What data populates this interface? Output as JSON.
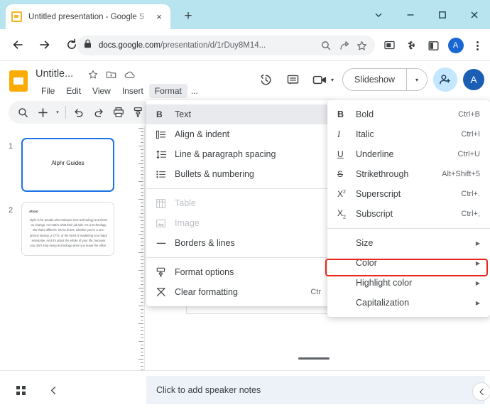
{
  "browser": {
    "tab": {
      "title": "Untitled presentation - Google S",
      "favicon": "slides-favicon",
      "close": "×"
    },
    "newtab_label": "+",
    "window_controls": [
      {
        "name": "minimize-tab-group-icon",
        "glyph": "chevron-down-icon"
      },
      {
        "name": "minimize-icon",
        "glyph": "minimize-icon"
      },
      {
        "name": "maximize-icon",
        "glyph": "maximize-icon"
      },
      {
        "name": "close-window-icon",
        "glyph": "close-icon"
      }
    ],
    "nav": {
      "back": "back-icon",
      "forward": "forward-icon",
      "reload": "reload-icon"
    },
    "omnibox": {
      "lock": "lock-icon",
      "host": "docs.google.com",
      "path": "/presentation/d/1rDuy8M14...",
      "full_url": "docs.google.com/presentation/d/1rDuy8M14...",
      "icons": [
        "search-icon",
        "share-icon",
        "bookmark-star-icon"
      ]
    },
    "extensions": [
      {
        "name": "screencast-icon"
      },
      {
        "name": "puzzle-extensions-icon"
      },
      {
        "name": "side-panel-icon"
      }
    ],
    "profile_initial": "A",
    "menu_icon": "kebab-menu-icon"
  },
  "app": {
    "logo": "google-slides-logo",
    "doc_title": "Untitle...",
    "title_icons": [
      "star-icon",
      "move-to-folder-icon",
      "cloud-saved-icon"
    ],
    "menus": [
      {
        "label": "File",
        "active": false
      },
      {
        "label": "Edit",
        "active": false
      },
      {
        "label": "View",
        "active": false
      },
      {
        "label": "Insert",
        "active": false
      },
      {
        "label": "Format",
        "active": true
      }
    ],
    "menu_more": "...",
    "header_right": {
      "icons": [
        {
          "name": "version-history-icon"
        },
        {
          "name": "comment-icon"
        },
        {
          "name": "meet-camera-icon"
        }
      ],
      "meet_caret": "▾",
      "slideshow_label": "Slideshow",
      "slideshow_caret": "▾",
      "share_icon": "add-person-icon",
      "avatar_initial": "A"
    }
  },
  "slides_toolbar": {
    "items": [
      {
        "name": "search-icon",
        "glyph": "search"
      },
      {
        "name": "new-slide-icon",
        "glyph": "plus"
      },
      {
        "name": "new-slide-caret-icon",
        "glyph": "caret"
      },
      {
        "name": "separator",
        "glyph": "sep"
      },
      {
        "name": "undo-icon",
        "glyph": "undo"
      },
      {
        "name": "redo-icon",
        "glyph": "redo"
      },
      {
        "name": "print-icon",
        "glyph": "print"
      },
      {
        "name": "paint-format-icon",
        "glyph": "paint"
      }
    ]
  },
  "filmstrip": {
    "slides": [
      {
        "number": "1",
        "selected": true,
        "title": "Alphr Guides",
        "heading": "",
        "body": ""
      },
      {
        "number": "2",
        "selected": false,
        "title": "",
        "heading": "About",
        "body": "Alphr is for people who embrace new technology and thrive on change, no matter what their job title. It's a technology site that's different: it's for doers, whether you're a one-person startup, a CTO, or the head of marketing at a major enterprise. And it's about the whole of your life, because you don't stop using technology when you leave the office."
      }
    ]
  },
  "format_menu": {
    "items": [
      {
        "icon": "bold-text-icon",
        "icon_glyph": "B",
        "label": "Text",
        "shortcut": "",
        "highlighted": true,
        "disabled": false,
        "arrow": false
      },
      {
        "icon": "align-indent-icon",
        "icon_glyph": "≡",
        "label": "Align & indent",
        "shortcut": "",
        "highlighted": false,
        "disabled": false,
        "arrow": false
      },
      {
        "icon": "line-spacing-icon",
        "icon_glyph": "↕",
        "label": "Line & paragraph spacing",
        "shortcut": "",
        "highlighted": false,
        "disabled": false,
        "arrow": false
      },
      {
        "icon": "bullets-numbering-icon",
        "icon_glyph": "☰",
        "label": "Bullets & numbering",
        "shortcut": "",
        "highlighted": false,
        "disabled": false,
        "arrow": false
      },
      {
        "separator": true
      },
      {
        "icon": "table-icon",
        "icon_glyph": "▦",
        "label": "Table",
        "shortcut": "",
        "highlighted": false,
        "disabled": true,
        "arrow": false
      },
      {
        "icon": "image-icon",
        "icon_glyph": "▣",
        "label": "Image",
        "shortcut": "",
        "highlighted": false,
        "disabled": true,
        "arrow": false
      },
      {
        "icon": "borders-lines-icon",
        "icon_glyph": "—",
        "label": "Borders & lines",
        "shortcut": "",
        "highlighted": false,
        "disabled": false,
        "arrow": false
      },
      {
        "separator": true
      },
      {
        "icon": "format-options-icon",
        "icon_glyph": "⬚",
        "label": "Format options",
        "shortcut": "",
        "highlighted": false,
        "disabled": false,
        "arrow": false
      },
      {
        "icon": "clear-formatting-icon",
        "icon_glyph": "✗",
        "label": "Clear formatting",
        "shortcut": "Ctr",
        "highlighted": false,
        "disabled": false,
        "arrow": false
      }
    ]
  },
  "text_submenu": {
    "items": [
      {
        "icon": "bold-icon",
        "icon_glyph": "B",
        "label": "Bold",
        "shortcut": "Ctrl+B",
        "arrow": false,
        "indent": false
      },
      {
        "icon": "italic-icon",
        "icon_glyph": "I",
        "label": "Italic",
        "shortcut": "Ctrl+I",
        "arrow": false,
        "indent": false
      },
      {
        "icon": "underline-icon",
        "icon_glyph": "U",
        "label": "Underline",
        "shortcut": "Ctrl+U",
        "arrow": false,
        "indent": false
      },
      {
        "icon": "strikethrough-icon",
        "icon_glyph": "S",
        "label": "Strikethrough",
        "shortcut": "Alt+Shift+5",
        "arrow": false,
        "indent": false
      },
      {
        "icon": "superscript-icon",
        "icon_glyph": "X²",
        "label": "Superscript",
        "shortcut": "Ctrl+.",
        "arrow": false,
        "indent": false
      },
      {
        "icon": "subscript-icon",
        "icon_glyph": "X₂",
        "label": "Subscript",
        "shortcut": "Ctrl+,",
        "arrow": false,
        "indent": false
      },
      {
        "separator": true
      },
      {
        "icon": "",
        "icon_glyph": "",
        "label": "Size",
        "shortcut": "",
        "arrow": true,
        "indent": true
      },
      {
        "icon": "",
        "icon_glyph": "",
        "label": "Color",
        "shortcut": "",
        "arrow": true,
        "indent": true,
        "outlined": true
      },
      {
        "icon": "",
        "icon_glyph": "",
        "label": "Highlight color",
        "shortcut": "",
        "arrow": true,
        "indent": true
      },
      {
        "icon": "",
        "icon_glyph": "",
        "label": "Capitalization",
        "shortcut": "",
        "arrow": true,
        "indent": true
      }
    ],
    "arrow_glyph": "▶"
  },
  "bottom_bar": {
    "grid_view_icon": "grid-view-icon",
    "collapse_filmstrip_icon": "chevron-left-icon",
    "speaker_notes_placeholder": "Click to add speaker notes",
    "collapse_right_icon": "chevron-left-icon"
  },
  "colors": {
    "titlebar": "#b7e4ee",
    "accent_blue": "#1a73e8",
    "highlight_red": "#e8271a",
    "slides_yellow": "#f9ab00",
    "share_blue": "#c2e7ff",
    "avatar_blue": "#1a5fb4",
    "notes_bg": "#edf1f8"
  }
}
